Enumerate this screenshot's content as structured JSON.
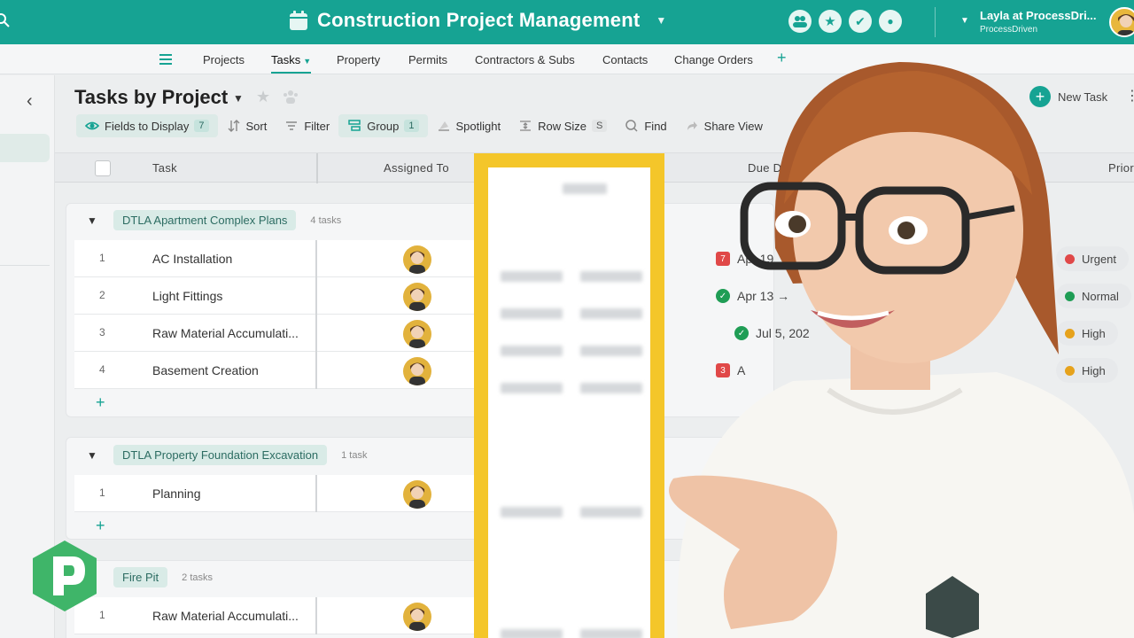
{
  "topbar": {
    "title": "Construction Project Management",
    "account_name": "Layla at ProcessDri...",
    "account_org": "ProcessDriven"
  },
  "nav": {
    "items": [
      "Projects",
      "Tasks",
      "Property",
      "Permits",
      "Contractors & Subs",
      "Contacts",
      "Change Orders"
    ],
    "active": "Tasks"
  },
  "page": {
    "title": "Tasks by Project",
    "new_task_label": "New Task"
  },
  "toolbar": {
    "fields_label": "Fields to Display",
    "fields_count": "7",
    "sort_label": "Sort",
    "filter_label": "Filter",
    "group_label": "Group",
    "group_count": "1",
    "spotlight_label": "Spotlight",
    "rowsize_label": "Row Size",
    "rowsize_value": "S",
    "find_label": "Find",
    "share_label": "Share View"
  },
  "columns": {
    "task": "Task",
    "assigned": "Assigned To",
    "due": "Due D",
    "priority": "Prior"
  },
  "groups": [
    {
      "name": "DTLA Apartment Complex Plans",
      "count": "4 tasks",
      "rows": [
        {
          "num": "1",
          "task": "AC Installation"
        },
        {
          "num": "2",
          "task": "Light Fittings"
        },
        {
          "num": "3",
          "task": "Raw Material Accumulati..."
        },
        {
          "num": "4",
          "task": "Basement Creation"
        }
      ]
    },
    {
      "name": "DTLA Property Foundation Excavation",
      "count": "1 task",
      "rows": [
        {
          "num": "1",
          "task": "Planning"
        }
      ]
    },
    {
      "name": "Fire Pit",
      "count": "2 tasks",
      "rows": [
        {
          "num": "1",
          "task": "Raw Material Accumulati..."
        }
      ]
    }
  ],
  "due_cells": [
    {
      "badge": "7",
      "text": "Apr 19"
    },
    {
      "badge": "✓",
      "text": "Apr 13 →"
    },
    {
      "badge": "✓",
      "text": "Jul 5, 202"
    },
    {
      "badge": "3",
      "text": "A"
    }
  ],
  "priorities": [
    {
      "label": "Urgent",
      "color": "#e04848"
    },
    {
      "label": "Normal",
      "color": "#1f9d55"
    },
    {
      "label": "High",
      "color": "#e6a21c"
    },
    {
      "label": "High",
      "color": "#e6a21c"
    }
  ],
  "colors": {
    "brand": "#16a393",
    "highlight": "#f4c62a"
  }
}
